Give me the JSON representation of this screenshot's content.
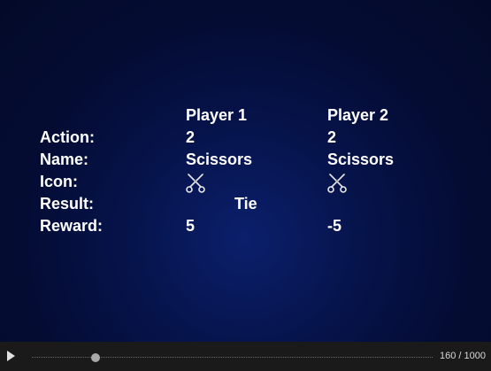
{
  "table": {
    "headers": {
      "player1": "Player 1",
      "player2": "Player 2"
    },
    "rows": {
      "action": {
        "label": "Action:",
        "p1": "2",
        "p2": "2"
      },
      "name": {
        "label": "Name:",
        "p1": "Scissors",
        "p2": "Scissors"
      },
      "icon": {
        "label": "Icon:",
        "p1_icon": "scissors-icon",
        "p2_icon": "scissors-icon"
      },
      "result": {
        "label": "Result:",
        "value": "Tie"
      },
      "reward": {
        "label": "Reward:",
        "p1": "5",
        "p2": "-5"
      }
    }
  },
  "player": {
    "frame_text": "160 / 1000",
    "progress": 0.16,
    "play_icon": "play-icon"
  }
}
